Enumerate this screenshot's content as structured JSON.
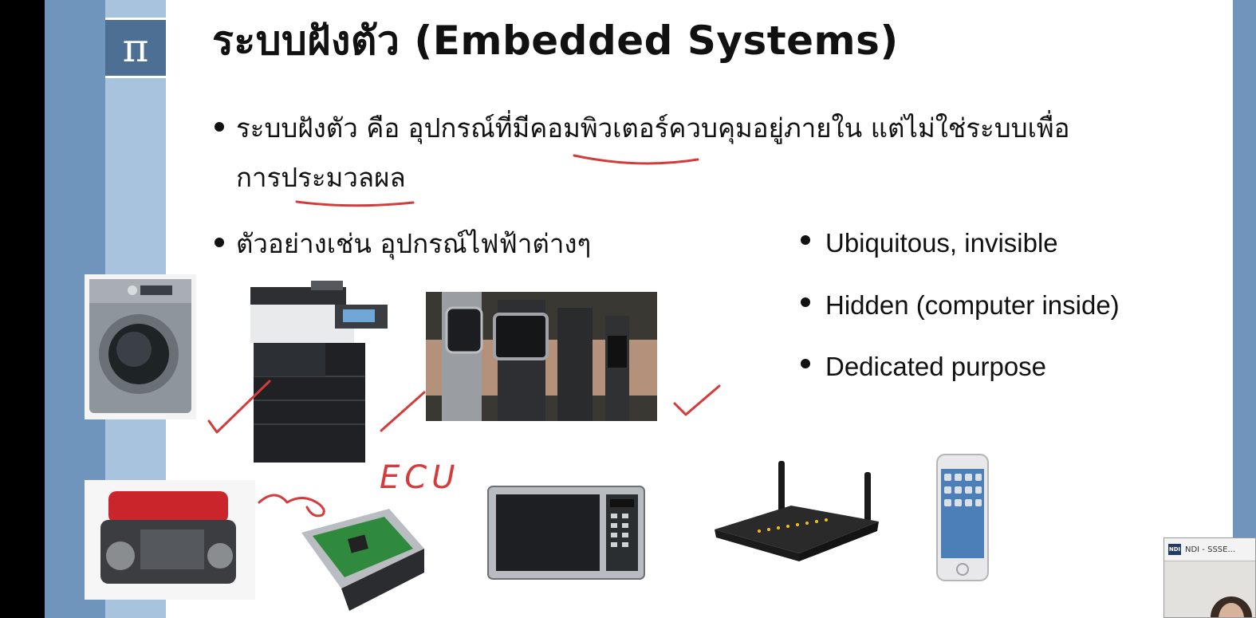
{
  "slide": {
    "pi_symbol": "π",
    "title": "ระบบฝังตัว (Embedded Systems)",
    "bullets_th": [
      "ระบบฝังตัว คือ อุปกรณ์ที่มีคอมพิวเตอร์ควบคุมอยู่ภายใน แต่ไม่ใช่ระบบเพื่อ",
      "การประมวลผล",
      "ตัวอย่างเช่น อุปกรณ์ไฟฟ้าต่างๆ"
    ],
    "bullets_en": [
      "Ubiquitous, invisible",
      "Hidden (computer inside)",
      "Dedicated purpose"
    ],
    "annotation_text": "ECU",
    "images": [
      "washing-machine",
      "printer",
      "smart-watches",
      "car-engine",
      "ecu-board",
      "microwave",
      "wifi-router",
      "smartphone"
    ]
  },
  "overlay": {
    "ndi_logo": "NDI",
    "ndi_title": "NDI - SSSE..."
  },
  "colors": {
    "stripe_dark": "#6f95bd",
    "stripe_light": "#a7c3de",
    "pi_box": "#4c6f93",
    "annotation_red": "#d63b3b"
  }
}
